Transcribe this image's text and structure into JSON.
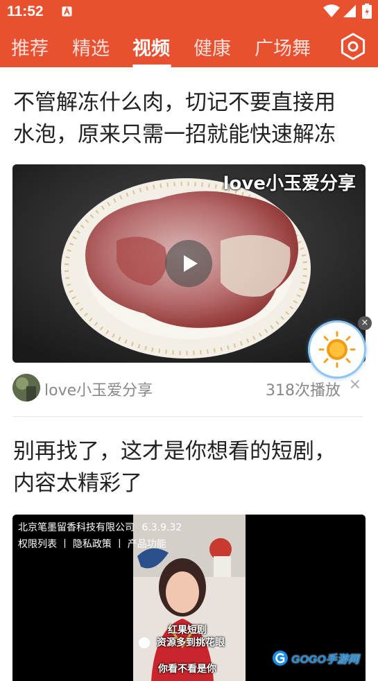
{
  "status_bar": {
    "time": "11:52",
    "icons": [
      "notification-a-icon",
      "wifi-icon",
      "cell-signal-icon",
      "battery-icon"
    ]
  },
  "tabs": [
    {
      "label": "推荐",
      "active": false
    },
    {
      "label": "精选",
      "active": false
    },
    {
      "label": "视频",
      "active": true
    },
    {
      "label": "健康",
      "active": false
    },
    {
      "label": "广场舞",
      "active": false
    }
  ],
  "feed": {
    "items": [
      {
        "title_line1": "不管解冻什么肉，切记不要直接用",
        "title_line2": "水泡，原来只需一招就能快速解冻",
        "thumbnail_overlay": "love小玉爱分享",
        "author": "love小玉爱分享",
        "plays": "318次播放",
        "dismiss": "×"
      },
      {
        "title_line1": "别再找了，这才是你想看的短剧，",
        "title_line2": "内容太精彩了",
        "company": "北京笔墨留香科技有限公司",
        "version": "6.3.9.32",
        "links": "权限列表 丨 隐私政策 丨 产品功能",
        "caption1": "红果短剧",
        "caption2": "资源多到挑花眼",
        "caption3": "你看不看是你"
      }
    ]
  },
  "floating_widget": {
    "close": "×"
  },
  "watermark": "GOGO手游网",
  "colors": {
    "header": "#e8502f",
    "text": "#222222",
    "meta": "#888888"
  }
}
